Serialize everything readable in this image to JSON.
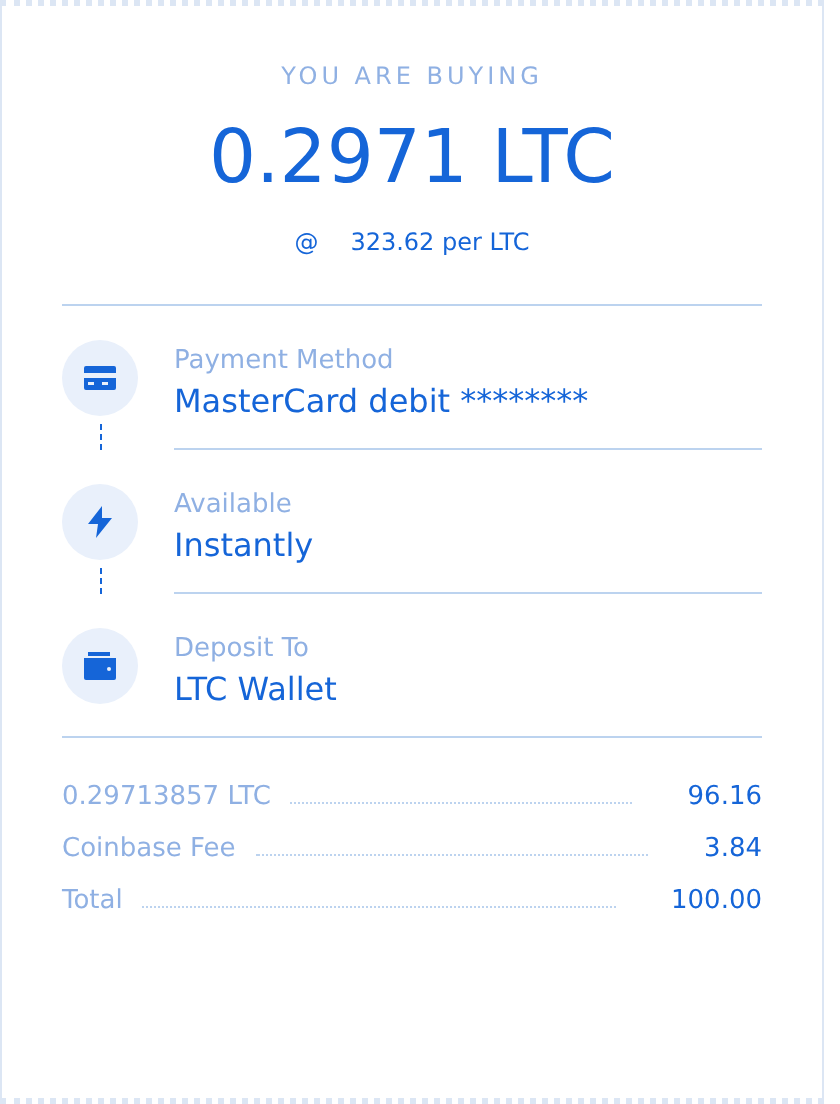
{
  "header": {
    "label": "YOU ARE BUYING",
    "amount": "0.2971 LTC",
    "rate_symbol": "@",
    "rate": "323.62 per LTC"
  },
  "steps": [
    {
      "kind": "card",
      "label": "Payment Method",
      "value": "MasterCard debit ********"
    },
    {
      "kind": "bolt",
      "label": "Available",
      "value": "Instantly"
    },
    {
      "kind": "wallet",
      "label": "Deposit To",
      "value": "LTC Wallet"
    }
  ],
  "summary": [
    {
      "label": "0.29713857 LTC",
      "value": "96.16"
    },
    {
      "label": "Coinbase Fee",
      "value": "3.84"
    },
    {
      "label": "Total",
      "value": "100.00"
    }
  ]
}
